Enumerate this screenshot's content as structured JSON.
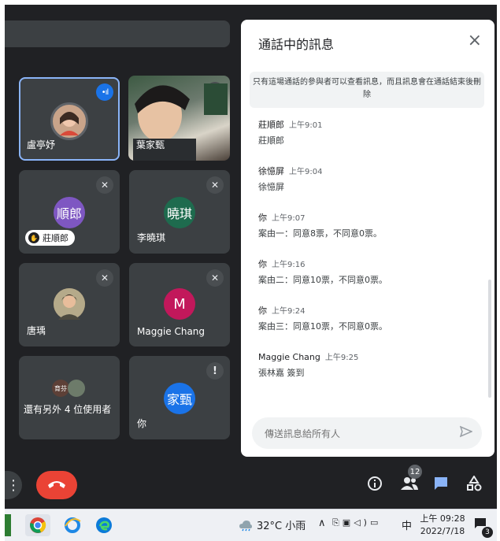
{
  "participants": [
    {
      "name": "盧亭妤",
      "status": "speaking"
    },
    {
      "name": "葉家甄",
      "status": "muted"
    },
    {
      "name": "",
      "initials": "順郎",
      "hand_raised": "莊順郎",
      "color": "#7e57c2"
    },
    {
      "name": "李曉琪",
      "initials": "曉琪",
      "color": "#1e6b4e"
    },
    {
      "name": "唐瑀",
      "status": "muted"
    },
    {
      "name": "Maggie Chang",
      "initials": "M",
      "color": "#c2185b"
    },
    {
      "name": "還有另外 4 位使用者",
      "mini_avatar": "育芬"
    },
    {
      "name": "你",
      "initials": "家甄",
      "color": "#1a73e8",
      "alert": "!"
    }
  ],
  "chat": {
    "title": "通話中的訊息",
    "close_icon": "×",
    "notice": "只有這場通話的參與者可以查看訊息，而且訊息會在通話結束後刪除",
    "messages": [
      {
        "sender": "莊順郎",
        "time": "上午9:01",
        "text": "莊順郎"
      },
      {
        "sender": "徐憶屏",
        "time": "上午9:04",
        "text": "徐憶屏"
      },
      {
        "sender": "你",
        "time": "上午9:07",
        "text": "案由一：同意8票，不同意0票。"
      },
      {
        "sender": "你",
        "time": "上午9:16",
        "text": "案由二：同意10票，不同意0票。"
      },
      {
        "sender": "你",
        "time": "上午9:24",
        "text": "案由三：同意10票，不同意0票。"
      },
      {
        "sender": "Maggie Chang",
        "time": "上午9:25",
        "text": "張林嘉 簽到"
      }
    ],
    "placeholder": "傳送訊息給所有人"
  },
  "controls": {
    "more_icon": "⋮",
    "people_badge": "12"
  },
  "taskbar": {
    "weather": "32°C 小雨",
    "ime": "中",
    "time": "上午 09:28",
    "date": "2022/7/18",
    "notifications": "3",
    "tray_arrow": "∧"
  }
}
